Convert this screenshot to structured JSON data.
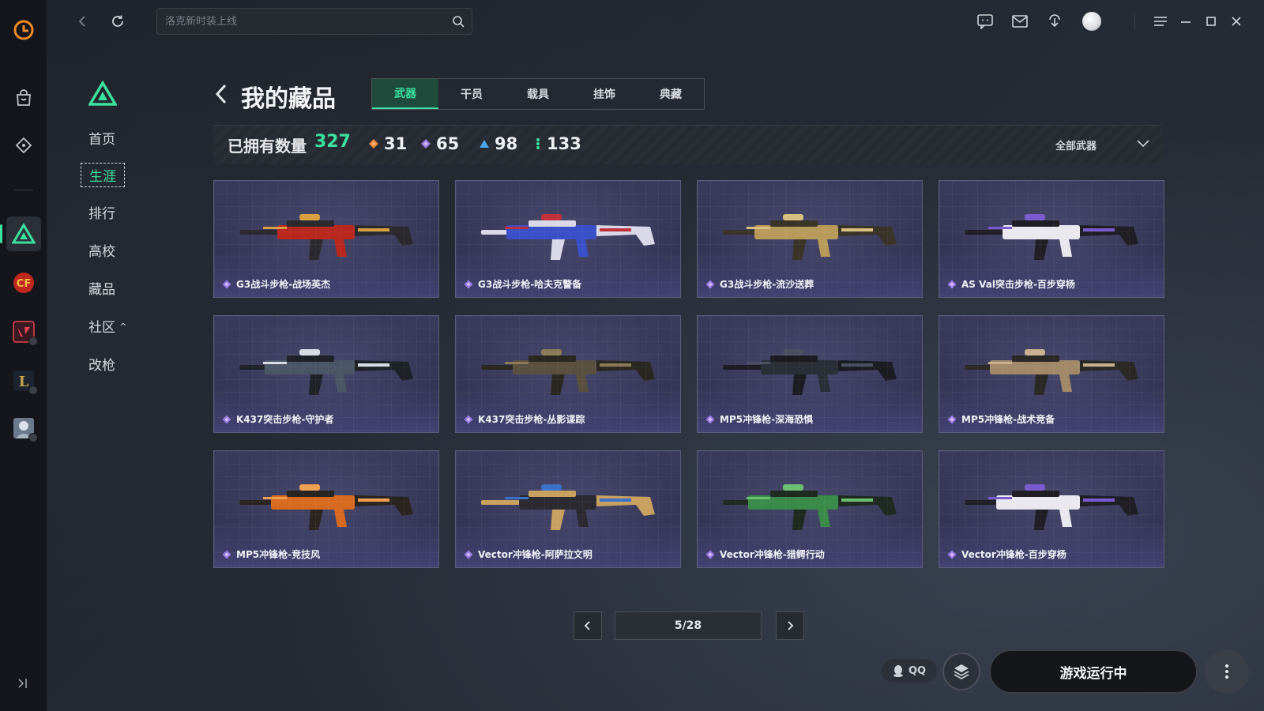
{
  "topbar": {
    "search_placeholder": "洛克新时装上线"
  },
  "subnav": {
    "items": [
      {
        "label": "首页"
      },
      {
        "label": "生涯"
      },
      {
        "label": "排行"
      },
      {
        "label": "高校"
      },
      {
        "label": "藏品"
      },
      {
        "label": "社区"
      },
      {
        "label": "改枪"
      }
    ],
    "active_index": 1
  },
  "page": {
    "title": "我的藏品",
    "tabs": [
      {
        "label": "武器"
      },
      {
        "label": "干员"
      },
      {
        "label": "载具"
      },
      {
        "label": "挂饰"
      },
      {
        "label": "典藏"
      }
    ],
    "active_tab": 0
  },
  "stats": {
    "owned_label": "已拥有数量",
    "owned_count": "327",
    "rarity_counts": [
      {
        "value": "31",
        "color": "#e8843a"
      },
      {
        "value": "65",
        "color": "#9b7be6"
      },
      {
        "value": "98",
        "color": "#4aa6e8"
      },
      {
        "value": "133",
        "color": "#3ce0a0"
      }
    ],
    "filter_value": "全部武器"
  },
  "items": [
    {
      "name": "G3战斗步枪-战场英杰",
      "palette": [
        "#b8281f",
        "#2a2a2e",
        "#d8a040"
      ]
    },
    {
      "name": "G3战斗步枪-哈夫克警备",
      "palette": [
        "#3a50c8",
        "#d8d8e8",
        "#c03038"
      ]
    },
    {
      "name": "G3战斗步枪-流沙送葬",
      "palette": [
        "#b89a5a",
        "#3a3428",
        "#d8c080"
      ]
    },
    {
      "name": "AS Val突击步枪-百步穿杨",
      "palette": [
        "#e8e8ee",
        "#1e1e24",
        "#7a5ad0"
      ]
    },
    {
      "name": "K437突击步枪-守护者",
      "palette": [
        "#4a5666",
        "#1e2228",
        "#d8dce4"
      ]
    },
    {
      "name": "K437突击步枪-丛影谍踪",
      "palette": [
        "#5a5040",
        "#2a2620",
        "#8a7a58"
      ]
    },
    {
      "name": "MP5冲锋枪-深海恐惧",
      "palette": [
        "#2a2e36",
        "#1a1c22",
        "#4a5060"
      ]
    },
    {
      "name": "MP5冲锋枪-战术竞备",
      "palette": [
        "#a08868",
        "#2a2824",
        "#c8b090"
      ]
    },
    {
      "name": "MP5冲锋枪-竞技风",
      "palette": [
        "#d86a20",
        "#2a2420",
        "#f0a050"
      ]
    },
    {
      "name": "Vector冲锋枪-阿萨拉文明",
      "palette": [
        "#2a2a30",
        "#c8a060",
        "#3a70c8"
      ]
    },
    {
      "name": "Vector冲锋枪-猎鳄行动",
      "palette": [
        "#3a8a4a",
        "#1e2a20",
        "#6ac070"
      ]
    },
    {
      "name": "Vector冲锋枪-百步穿杨",
      "palette": [
        "#e8e8ee",
        "#1e1e24",
        "#7a5ad0"
      ]
    }
  ],
  "pagination": {
    "indicator": "5/28"
  },
  "bottom": {
    "qq_label": "QQ",
    "launch_label": "游戏运行中"
  },
  "colors": {
    "accent": "#3ce0a0",
    "card_border": "#5a5d78",
    "item_gem": "#9b7be6"
  }
}
